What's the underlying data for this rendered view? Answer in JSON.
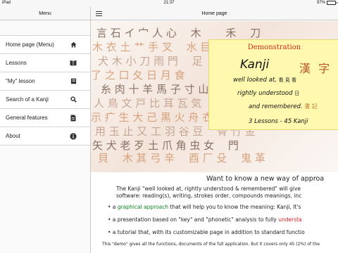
{
  "statusbar": {
    "device": "iPad",
    "time": "21:37",
    "battery": "97%",
    "battery_level": 0.97
  },
  "sidebar": {
    "title": "Menu",
    "items": [
      {
        "label": "Home page (Menu)",
        "icon": "home-icon"
      },
      {
        "label": "Lessons",
        "icon": "book-icon"
      },
      {
        "label": "\"My\" lesson",
        "icon": "notebook-icon"
      },
      {
        "label": "Search of a Kanji",
        "icon": "search-icon"
      },
      {
        "label": "General features",
        "icon": "document-icon"
      },
      {
        "label": "About",
        "icon": "info-icon"
      }
    ]
  },
  "main": {
    "title": "Home page",
    "demo": {
      "title": "Demonstration",
      "word": "Kanji",
      "chars": "漢 字",
      "line1": "well looked at,",
      "line1_glyphs": "看 見 看",
      "line2": "rightly understood",
      "line2_glyphs": "日",
      "line3": "and remembered.",
      "line3_glyphs": "書 記",
      "lessons": "3 Lessons  -  45 Kanji"
    },
    "intro": {
      "heading": "Want to know a new way of approa",
      "p1_a": "The Kanji \"well looked at, rightly understood & remembered\" will give",
      "p1_b": "software: reading(s), writing, strokes order, compounds meanings, inc",
      "b1_pre": "• a ",
      "b1_hl": "graphical approach",
      "b1_post": " that will help you to know the meaning: Kanji, It's",
      "b2_pre": "• a presentation based on \"key\" and \"phonetic\" analysis to fully ",
      "b2_hl": "understa",
      "b3": "• a tutorial that, with its customizable page in addition to standard functio",
      "foot": "This \"demo\" gives all the functions, documents of the full application. But it covers only 45 (2%) of the"
    }
  },
  "colors": {
    "demo_title": "#d42a1a",
    "highlight_green": "#0a8a25",
    "highlight_red": "#d21e1e"
  }
}
